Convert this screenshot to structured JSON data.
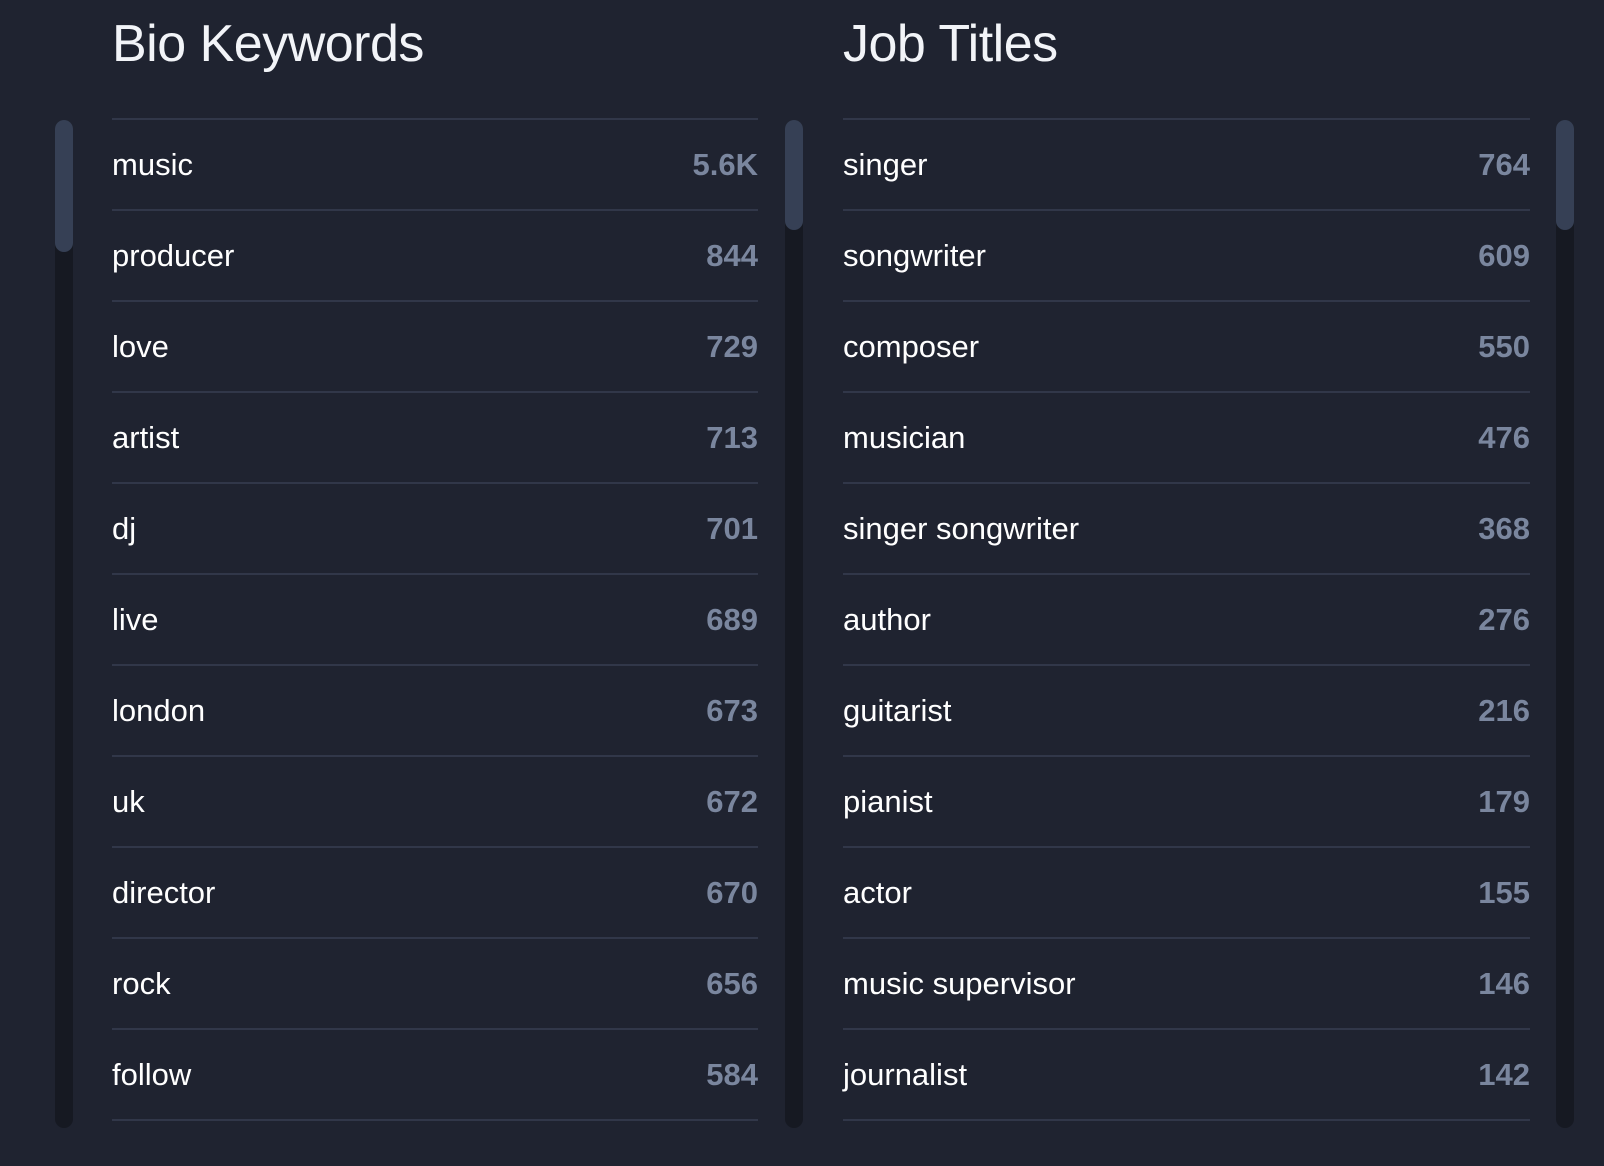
{
  "bio_keywords": {
    "title": "Bio Keywords",
    "scroll_position": 0,
    "items": [
      {
        "label": "music",
        "count": "5.6K"
      },
      {
        "label": "producer",
        "count": "844"
      },
      {
        "label": "love",
        "count": "729"
      },
      {
        "label": "artist",
        "count": "713"
      },
      {
        "label": "dj",
        "count": "701"
      },
      {
        "label": "live",
        "count": "689"
      },
      {
        "label": "london",
        "count": "673"
      },
      {
        "label": "uk",
        "count": "672"
      },
      {
        "label": "director",
        "count": "670"
      },
      {
        "label": "rock",
        "count": "656"
      },
      {
        "label": "follow",
        "count": "584"
      }
    ]
  },
  "job_titles": {
    "title": "Job Titles",
    "scroll_position": 0,
    "items": [
      {
        "label": "singer",
        "count": "764"
      },
      {
        "label": "songwriter",
        "count": "609"
      },
      {
        "label": "composer",
        "count": "550"
      },
      {
        "label": "musician",
        "count": "476"
      },
      {
        "label": "singer songwriter",
        "count": "368"
      },
      {
        "label": "author",
        "count": "276"
      },
      {
        "label": "guitarist",
        "count": "216"
      },
      {
        "label": "pianist",
        "count": "179"
      },
      {
        "label": "actor",
        "count": "155"
      },
      {
        "label": "music supervisor",
        "count": "146"
      },
      {
        "label": "journalist",
        "count": "142"
      }
    ]
  },
  "colors": {
    "background": "#1f2330",
    "count_text": "#7a869e",
    "divider": "#313749",
    "scroll_thumb": "#364055"
  }
}
